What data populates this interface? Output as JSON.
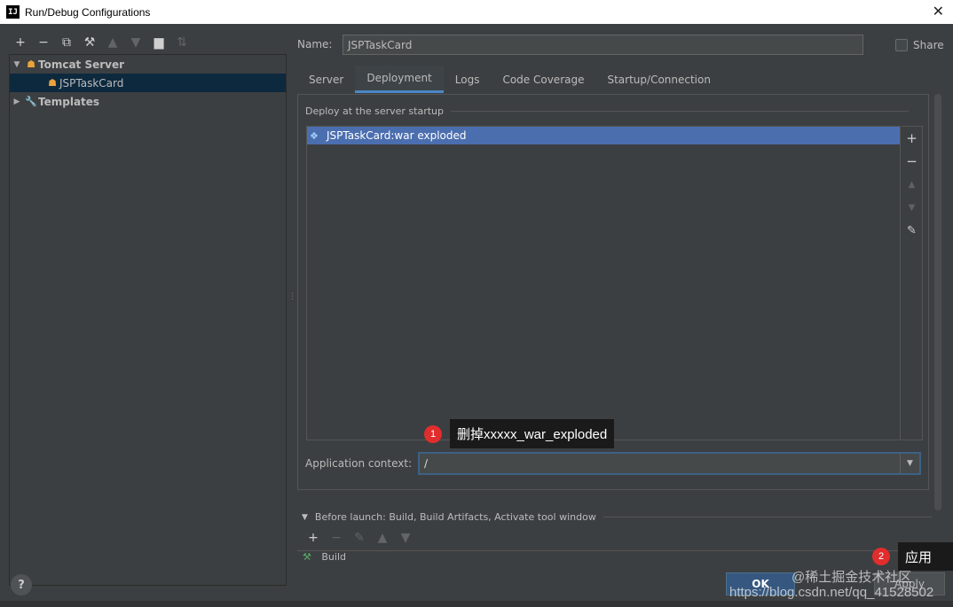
{
  "window": {
    "title": "Run/Debug Configurations",
    "logo": "IJ"
  },
  "left_toolbar": [
    {
      "icon": "plus-icon",
      "glyph": "+"
    },
    {
      "icon": "minus-icon",
      "glyph": "−"
    },
    {
      "icon": "copy-icon",
      "glyph": "⧉"
    },
    {
      "icon": "wrench-icon",
      "glyph": "🔧"
    },
    {
      "icon": "arrow-up-icon",
      "glyph": "▲"
    },
    {
      "icon": "arrow-down-icon",
      "glyph": "▼"
    },
    {
      "icon": "folder-add-icon",
      "glyph": "▇"
    },
    {
      "icon": "sort-icon",
      "glyph": "⇅"
    }
  ],
  "tree": {
    "group": "Tomcat Server",
    "item": "JSPTaskCard",
    "templates": "Templates"
  },
  "name": {
    "label": "Name:",
    "value": "JSPTaskCard"
  },
  "share_label": "Share",
  "tabs": [
    "Server",
    "Deployment",
    "Logs",
    "Code Coverage",
    "Startup/Connection"
  ],
  "deployment": {
    "section_title": "Deploy at the server startup",
    "items": [
      "JSPTaskCard:war exploded"
    ],
    "context_label": "Application context:",
    "context_value": "/"
  },
  "before_launch": {
    "title": "Before launch: Build, Build Artifacts, Activate tool window",
    "items": [
      "Build"
    ]
  },
  "buttons": {
    "ok": "OK",
    "apply": "Apply",
    "help": "?"
  },
  "annotations": [
    {
      "number": "1",
      "text": "删掉xxxxx_war_exploded"
    },
    {
      "number": "2",
      "text": "应用"
    }
  ],
  "watermark": {
    "line1": "@稀土掘金技术社区",
    "line2": "https://blog.csdn.net/qq_41528502"
  },
  "colors": {
    "accent": "#4a88c7",
    "selection": "#4b6eaf",
    "badge": "#e02d2d"
  }
}
